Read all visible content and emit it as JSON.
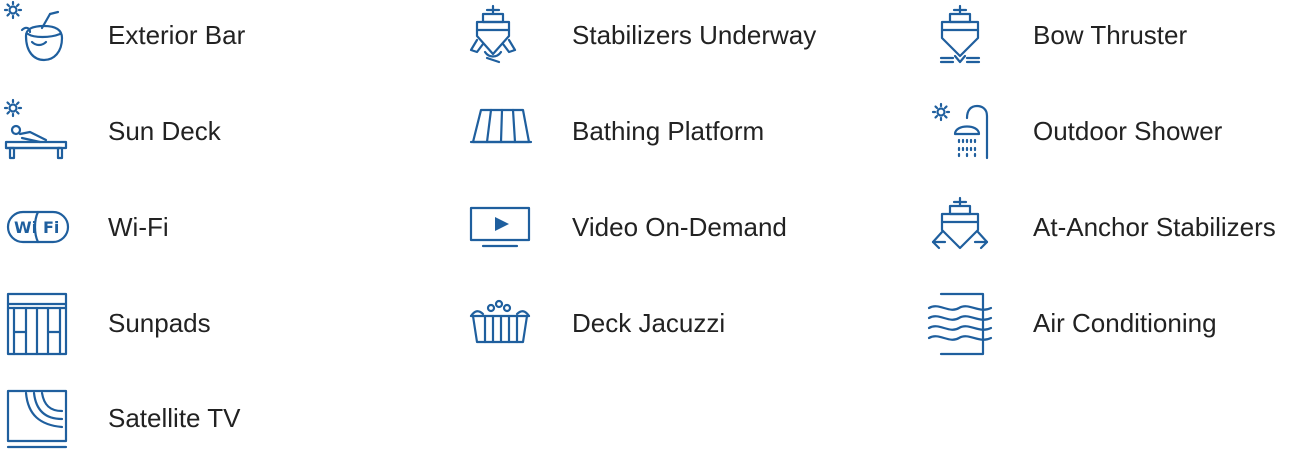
{
  "theme": {
    "icon_color": "#1f5f9e",
    "text_color": "#222222"
  },
  "amenities": [
    {
      "label": "Exterior Bar",
      "icon": "cocktail-icon"
    },
    {
      "label": "Stabilizers Underway",
      "icon": "stabilizers-underway-icon"
    },
    {
      "label": "Bow Thruster",
      "icon": "bow-thruster-icon"
    },
    {
      "label": "Sun Deck",
      "icon": "sun-deck-icon"
    },
    {
      "label": "Bathing Platform",
      "icon": "bathing-platform-icon"
    },
    {
      "label": "Outdoor Shower",
      "icon": "outdoor-shower-icon"
    },
    {
      "label": "Wi-Fi",
      "icon": "wifi-icon"
    },
    {
      "label": "Video On-Demand",
      "icon": "video-on-demand-icon"
    },
    {
      "label": "At-Anchor Stabilizers",
      "icon": "at-anchor-stabilizers-icon"
    },
    {
      "label": "Sunpads",
      "icon": "sunpads-icon"
    },
    {
      "label": "Deck Jacuzzi",
      "icon": "jacuzzi-icon"
    },
    {
      "label": "Air Conditioning",
      "icon": "air-conditioning-icon"
    },
    {
      "label": "Satellite TV",
      "icon": "satellite-tv-icon"
    }
  ],
  "icon_wifi_text": {
    "left": "Wi",
    "right": "Fi"
  }
}
